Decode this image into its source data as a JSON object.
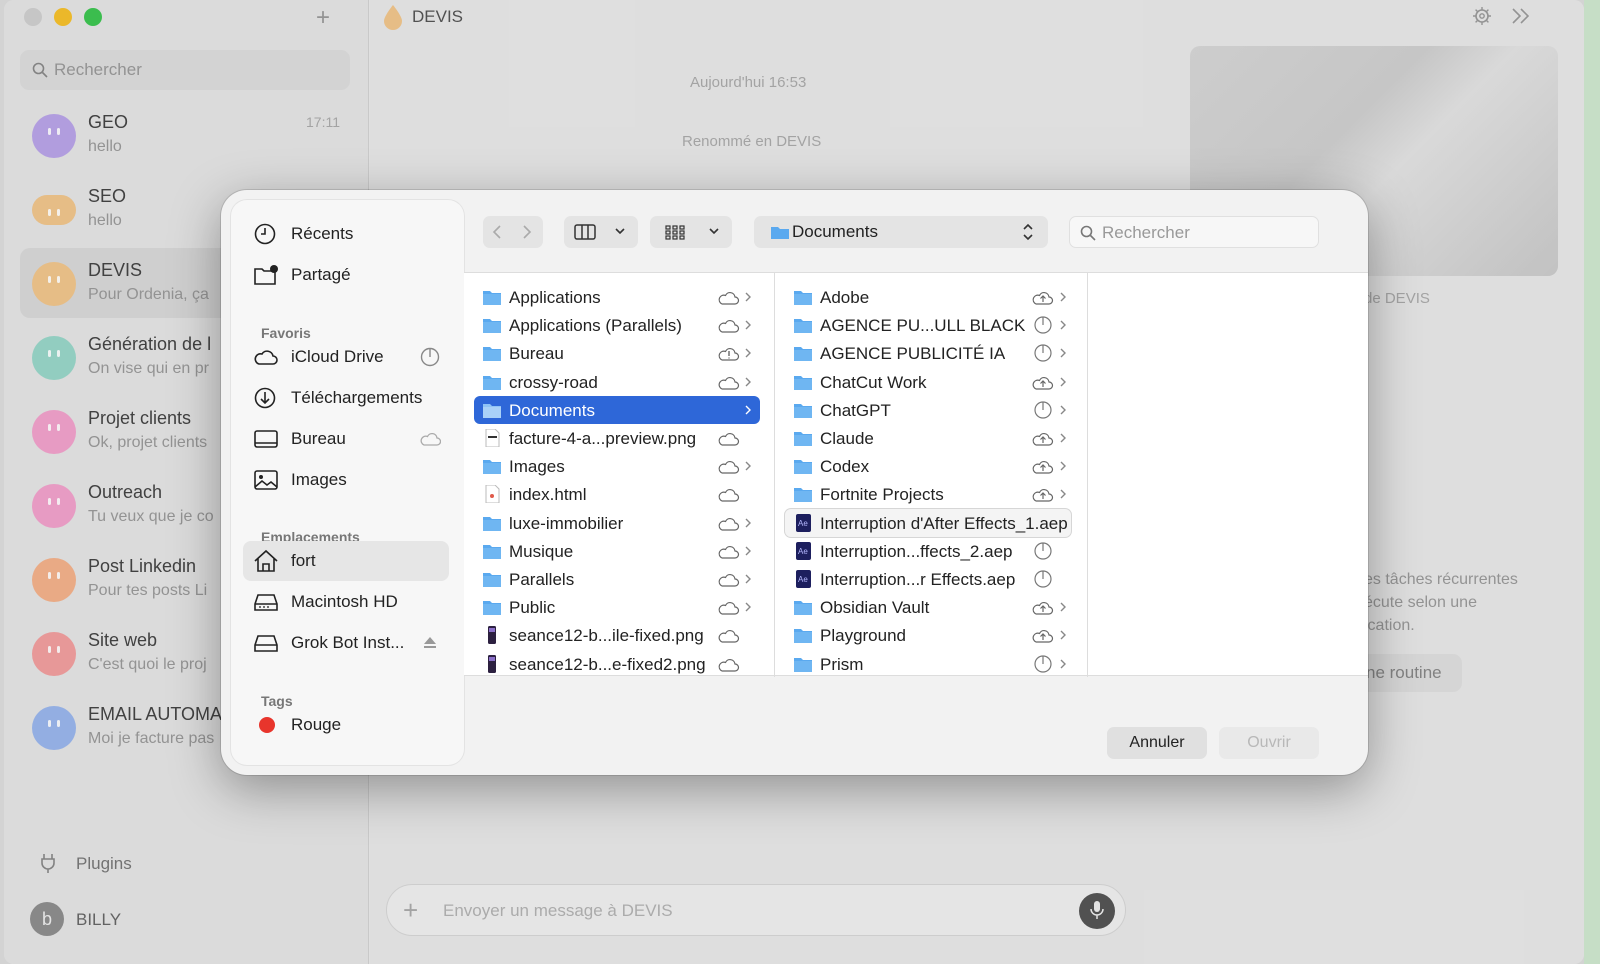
{
  "sidebar": {
    "search_placeholder": "Rechercher",
    "chats": [
      {
        "name": "GEO",
        "preview": "hello",
        "time": "17:11",
        "color": "#b9a4e8"
      },
      {
        "name": "SEO",
        "preview": "hello",
        "time": "",
        "color": "#f0c58c"
      },
      {
        "name": "DEVIS",
        "preview": "Pour Ordenia, ça",
        "time": "",
        "color": "#f0c58c"
      },
      {
        "name": "Génération de l",
        "preview": "On vise qui en pr",
        "time": "",
        "color": "#98d6c8"
      },
      {
        "name": "Projet clients",
        "preview": "Ok, projet clients",
        "time": "",
        "color": "#f1a2cb"
      },
      {
        "name": "Outreach",
        "preview": "Tu veux que je co",
        "time": "",
        "color": "#f1a2cb"
      },
      {
        "name": "Post Linkedin",
        "preview": "Pour tes posts Li",
        "time": "",
        "color": "#f3b18b"
      },
      {
        "name": "Site web",
        "preview": "C'est quoi le proj",
        "time": "",
        "color": "#f19f9f"
      },
      {
        "name": "EMAIL AUTOMA",
        "preview": "Moi je facture pas",
        "time": "",
        "color": "#9ab6ec"
      }
    ],
    "plugins_label": "Plugins",
    "user_initial": "b",
    "user_name": "BILLY"
  },
  "main": {
    "title": "DEVIS",
    "date_label": "Aujourd'hui 16:53",
    "renamed_label": "Renommé en DEVIS",
    "side_caption": "de DEVIS",
    "routine_text_1": "es tâches récurrentes",
    "routine_text_2": "écute selon une",
    "routine_text_3": "ication.",
    "routine_button": "ne routine",
    "composer_placeholder": "Envoyer un message à DEVIS"
  },
  "dialog": {
    "sidebar": {
      "recents": "Récents",
      "shared": "Partagé",
      "favorites_header": "Favoris",
      "icloud": "iCloud Drive",
      "downloads": "Téléchargements",
      "desktop": "Bureau",
      "images": "Images",
      "locations_header": "Emplacements",
      "home": "fort",
      "disk": "Macintosh HD",
      "volume": "Grok Bot Inst...",
      "tags_header": "Tags",
      "tag_red": "Rouge"
    },
    "toolbar": {
      "location": "Documents",
      "search_placeholder": "Rechercher"
    },
    "col1": [
      {
        "name": "Applications",
        "type": "folder",
        "status": "cloud",
        "arrow": true
      },
      {
        "name": "Applications (Parallels)",
        "type": "folder",
        "status": "cloud",
        "arrow": true
      },
      {
        "name": "Bureau",
        "type": "folder",
        "status": "cloud-alert",
        "arrow": true
      },
      {
        "name": "crossy-road",
        "type": "folder",
        "status": "cloud",
        "arrow": true
      },
      {
        "name": "Documents",
        "type": "folder",
        "status": "",
        "arrow": true,
        "selected": true
      },
      {
        "name": "facture-4-a...preview.png",
        "type": "image",
        "status": "cloud",
        "arrow": false
      },
      {
        "name": "Images",
        "type": "folder",
        "status": "cloud",
        "arrow": true
      },
      {
        "name": "index.html",
        "type": "html",
        "status": "cloud",
        "arrow": false
      },
      {
        "name": "luxe-immobilier",
        "type": "folder",
        "status": "cloud",
        "arrow": true
      },
      {
        "name": "Musique",
        "type": "folder",
        "status": "cloud",
        "arrow": true
      },
      {
        "name": "Parallels",
        "type": "folder",
        "status": "cloud",
        "arrow": true
      },
      {
        "name": "Public",
        "type": "folder",
        "status": "cloud",
        "arrow": true
      },
      {
        "name": "seance12-b...ile-fixed.png",
        "type": "phone",
        "status": "cloud",
        "arrow": false
      },
      {
        "name": "seance12-b...e-fixed2.png",
        "type": "phone",
        "status": "cloud",
        "arrow": false
      }
    ],
    "col2": [
      {
        "name": "Adobe",
        "type": "folder",
        "status": "cloud-up",
        "arrow": true
      },
      {
        "name": "AGENCE PU...ULL BLACK",
        "type": "folder",
        "status": "sync",
        "arrow": true
      },
      {
        "name": "AGENCE PUBLICITÉ IA",
        "type": "folder",
        "status": "sync",
        "arrow": true
      },
      {
        "name": "ChatCut Work",
        "type": "folder",
        "status": "cloud-up",
        "arrow": true
      },
      {
        "name": "ChatGPT",
        "type": "folder",
        "status": "sync",
        "arrow": true
      },
      {
        "name": "Claude",
        "type": "folder",
        "status": "cloud-up",
        "arrow": true
      },
      {
        "name": "Codex",
        "type": "folder",
        "status": "cloud-up",
        "arrow": true
      },
      {
        "name": "Fortnite Projects",
        "type": "folder",
        "status": "cloud-up",
        "arrow": true
      },
      {
        "name": "Interruption d'After Effects_1.aep",
        "type": "aep",
        "status": "",
        "arrow": false,
        "hover": true
      },
      {
        "name": "Interruption...ffects_2.aep",
        "type": "aep",
        "status": "sync",
        "arrow": false
      },
      {
        "name": "Interruption...r Effects.aep",
        "type": "aep",
        "status": "sync",
        "arrow": false
      },
      {
        "name": "Obsidian Vault",
        "type": "folder",
        "status": "cloud-up",
        "arrow": true
      },
      {
        "name": "Playground",
        "type": "folder",
        "status": "cloud-up",
        "arrow": true
      },
      {
        "name": "Prism",
        "type": "folder",
        "status": "sync",
        "arrow": true
      }
    ],
    "cancel_label": "Annuler",
    "open_label": "Ouvrir"
  },
  "colors": {
    "accent": "#2e67d8",
    "folder": "#5aa9ef",
    "tag_red": "#e8352c",
    "traffic_green": "#3ec552",
    "traffic_yellow": "#f5c02c"
  }
}
